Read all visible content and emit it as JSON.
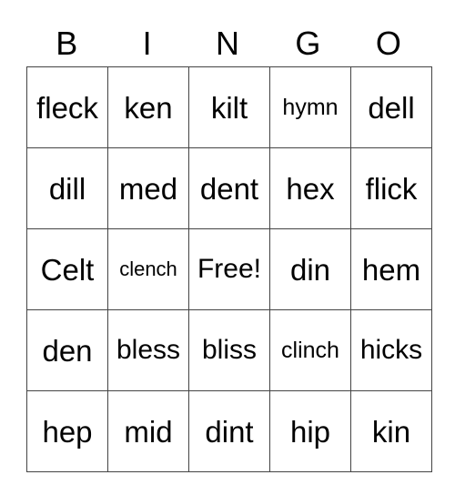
{
  "card": {
    "header": [
      "B",
      "I",
      "N",
      "G",
      "O"
    ],
    "rows": [
      [
        "fleck",
        "ken",
        "kilt",
        "hymn",
        "dell"
      ],
      [
        "dill",
        "med",
        "dent",
        "hex",
        "flick"
      ],
      [
        "Celt",
        "clench",
        "Free!",
        "din",
        "hem"
      ],
      [
        "den",
        "bless",
        "bliss",
        "clinch",
        "hicks"
      ],
      [
        "hep",
        "mid",
        "dint",
        "hip",
        "kin"
      ]
    ]
  }
}
